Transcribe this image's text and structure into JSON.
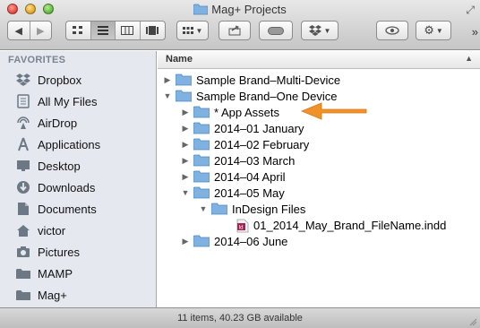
{
  "window": {
    "title": "Mag+ Projects"
  },
  "toolbar": {
    "back_icon": "chevron-left-icon",
    "forward_icon": "chevron-right-icon",
    "view_modes": [
      "icon-view-icon",
      "list-view-icon",
      "column-view-icon",
      "coverflow-view-icon"
    ],
    "arrange_icon": "arrange-grid-icon",
    "share_icon": "share-icon",
    "tags_icon": "tag-toggle-icon",
    "dropbox_icon": "dropbox-icon",
    "quicklook_icon": "eye-icon",
    "action_icon": "gear-icon",
    "overflow_label": "»"
  },
  "sidebar": {
    "header": "FAVORITES",
    "items": [
      {
        "label": "Dropbox",
        "icon": "dropbox-icon"
      },
      {
        "label": "All My Files",
        "icon": "all-files-icon"
      },
      {
        "label": "AirDrop",
        "icon": "airdrop-icon"
      },
      {
        "label": "Applications",
        "icon": "applications-icon"
      },
      {
        "label": "Desktop",
        "icon": "desktop-icon"
      },
      {
        "label": "Downloads",
        "icon": "downloads-icon"
      },
      {
        "label": "Documents",
        "icon": "documents-icon"
      },
      {
        "label": "victor",
        "icon": "home-icon"
      },
      {
        "label": "Pictures",
        "icon": "pictures-icon"
      },
      {
        "label": "MAMP",
        "icon": "folder-icon"
      },
      {
        "label": "Mag+",
        "icon": "folder-icon"
      }
    ]
  },
  "list": {
    "column_header": "Name",
    "sort_indicator": "▲",
    "rows": [
      {
        "name": "Sample Brand–Multi-Device",
        "expanded": false,
        "kind": "folder"
      },
      {
        "name": "Sample Brand–One Device",
        "expanded": true,
        "kind": "folder"
      },
      {
        "name": "* App Assets",
        "expanded": false,
        "kind": "folder"
      },
      {
        "name": "2014–01 January",
        "expanded": false,
        "kind": "folder"
      },
      {
        "name": "2014–02 February",
        "expanded": false,
        "kind": "folder"
      },
      {
        "name": "2014–03 March",
        "expanded": false,
        "kind": "folder"
      },
      {
        "name": "2014–04 April",
        "expanded": false,
        "kind": "folder"
      },
      {
        "name": "2014–05 May",
        "expanded": true,
        "kind": "folder"
      },
      {
        "name": "InDesign Files",
        "expanded": true,
        "kind": "folder"
      },
      {
        "name": "01_2014_May_Brand_FileName.indd",
        "expanded": null,
        "kind": "indd"
      },
      {
        "name": "2014–06 June",
        "expanded": false,
        "kind": "folder"
      }
    ]
  },
  "status": {
    "text": "11 items, 40.23 GB available"
  },
  "colors": {
    "sidebar_bg": "#e5e9ef",
    "folder": "#7fb2e0",
    "arrow": "#f0922a",
    "indd": "#d6336c"
  }
}
